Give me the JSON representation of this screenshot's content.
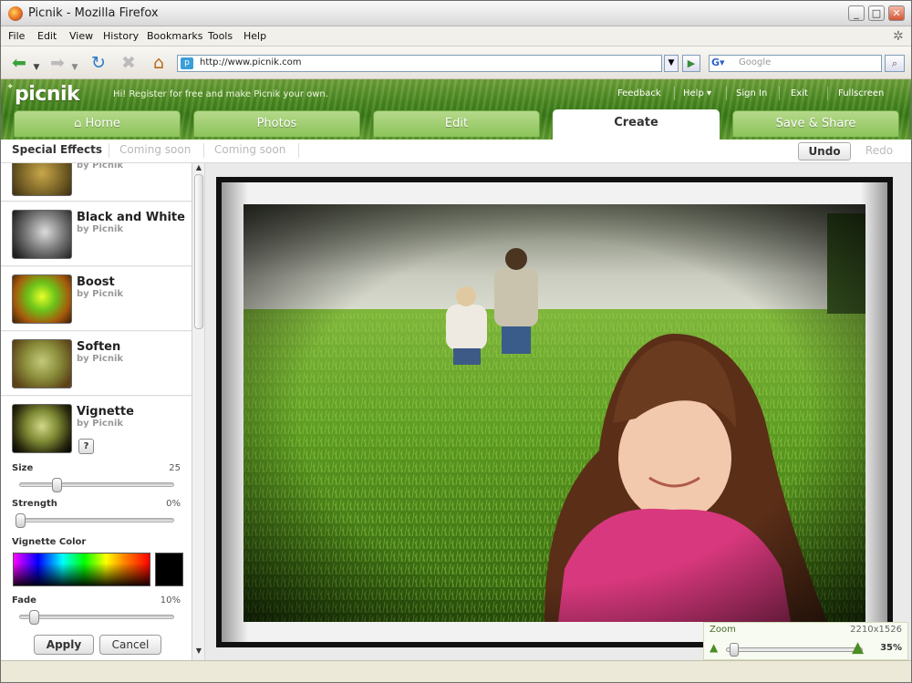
{
  "window": {
    "title": "Picnik - Mozilla Firefox"
  },
  "menubar": {
    "items": [
      "File",
      "Edit",
      "View",
      "History",
      "Bookmarks",
      "Tools",
      "Help"
    ]
  },
  "navbar": {
    "url": "http://www.picnik.com",
    "search_placeholder": "Google"
  },
  "picnik": {
    "logo": "picnik",
    "register_text": "Hi! Register for free and make Picnik your own.",
    "toplinks": [
      "Feedback",
      "Help ▾",
      "Sign In",
      "Exit",
      "Fullscreen"
    ],
    "tabs": [
      "⌂ Home",
      "Photos",
      "Edit",
      "Create",
      "Save & Share"
    ],
    "active_tab": "Create"
  },
  "subbar": {
    "tabs": [
      "Special Effects",
      "Coming soon",
      "Coming soon"
    ],
    "undo": "Undo",
    "redo": "Redo"
  },
  "effects": [
    {
      "name": "",
      "by": "by Picnik"
    },
    {
      "name": "Black and White",
      "by": "by Picnik"
    },
    {
      "name": "Boost",
      "by": "by Picnik"
    },
    {
      "name": "Soften",
      "by": "by Picnik"
    },
    {
      "name": "Vignette",
      "by": "by Picnik"
    }
  ],
  "vignette": {
    "help": "?",
    "size_label": "Size",
    "size_value": "25",
    "strength_label": "Strength",
    "strength_value": "0%",
    "color_label": "Vignette Color",
    "fade_label": "Fade",
    "fade_value": "10%",
    "apply": "Apply",
    "cancel": "Cancel",
    "selected_color": "#000000"
  },
  "zoom": {
    "label": "Zoom",
    "dimensions": "2210x1526",
    "percent": "35%"
  },
  "colors": {
    "picnik_green": "#4b8a21",
    "tab_green": "#8dc45a"
  }
}
